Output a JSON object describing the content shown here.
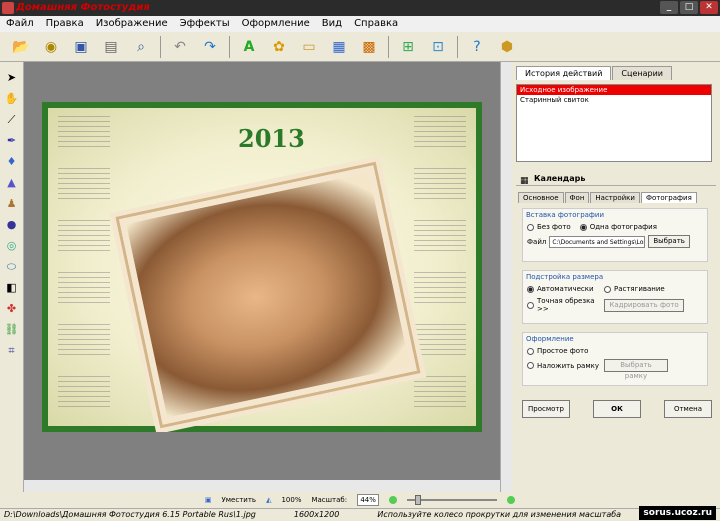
{
  "window": {
    "title": "Домашняя Фотостудия",
    "buttons": [
      "_",
      "□",
      "✕"
    ]
  },
  "menu": [
    "Файл",
    "Правка",
    "Изображение",
    "Эффекты",
    "Оформление",
    "Вид",
    "Справка"
  ],
  "toolbar": [
    "folder-icon",
    "film-icon",
    "save-icon",
    "print-icon",
    "zoom-icon",
    "undo-icon",
    "redo-icon",
    "text-icon",
    "palette-icon",
    "frame-icon",
    "calendar-icon",
    "picture-icon",
    "resize-icon",
    "scale-icon",
    "help-icon",
    "box-icon"
  ],
  "lefttools": [
    "arrow-icon",
    "hand-icon",
    "wand-icon",
    "pen-icon",
    "drop-icon",
    "triangle-icon",
    "stamp-icon",
    "ellipse-icon",
    "ring-icon",
    "oval-icon",
    "contrast-icon",
    "colors-icon",
    "link-icon",
    "crop-icon"
  ],
  "canvas": {
    "year": "2013"
  },
  "history": {
    "tabs": [
      "История действий",
      "Сценарии"
    ],
    "items": [
      "Исходное изображение",
      "Старинный свиток"
    ]
  },
  "calendar": {
    "title": "Календарь",
    "tabs": [
      "Основное",
      "Фон",
      "Настройки",
      "Фотография"
    ],
    "insert": {
      "title": "Вставка фотографии",
      "no_photo": "Без фото",
      "one_photo": "Одна фотография",
      "file_label": "Файл",
      "file_value": "C:\\Documents and Settings\\Lor",
      "browse": "Выбрать"
    },
    "size": {
      "title": "Подстройка размера",
      "auto": "Автоматически",
      "stretch": "Растягивание",
      "crop": "Точная обрезка >>",
      "crop_btn": "Кадрировать фото"
    },
    "design": {
      "title": "Оформление",
      "simple": "Простое фото",
      "frame": "Наложить рамку",
      "frame_btn": "Выбрать рамку"
    },
    "buttons": {
      "preview": "Просмотр",
      "ok": "ОК",
      "cancel": "Отмена"
    }
  },
  "status": {
    "fit": "Уместить",
    "full": "100%",
    "scale_label": "Масштаб:",
    "scale": "44%"
  },
  "pathbar": {
    "path": "D:\\Downloads\\Домашняя Фотостудия 6.15 Portable Rus\\1.jpg",
    "size": "1600x1200",
    "hint": "Используйте колесо прокрутки для изменения масштаба",
    "watermark": "sorus.ucoz.ru"
  }
}
